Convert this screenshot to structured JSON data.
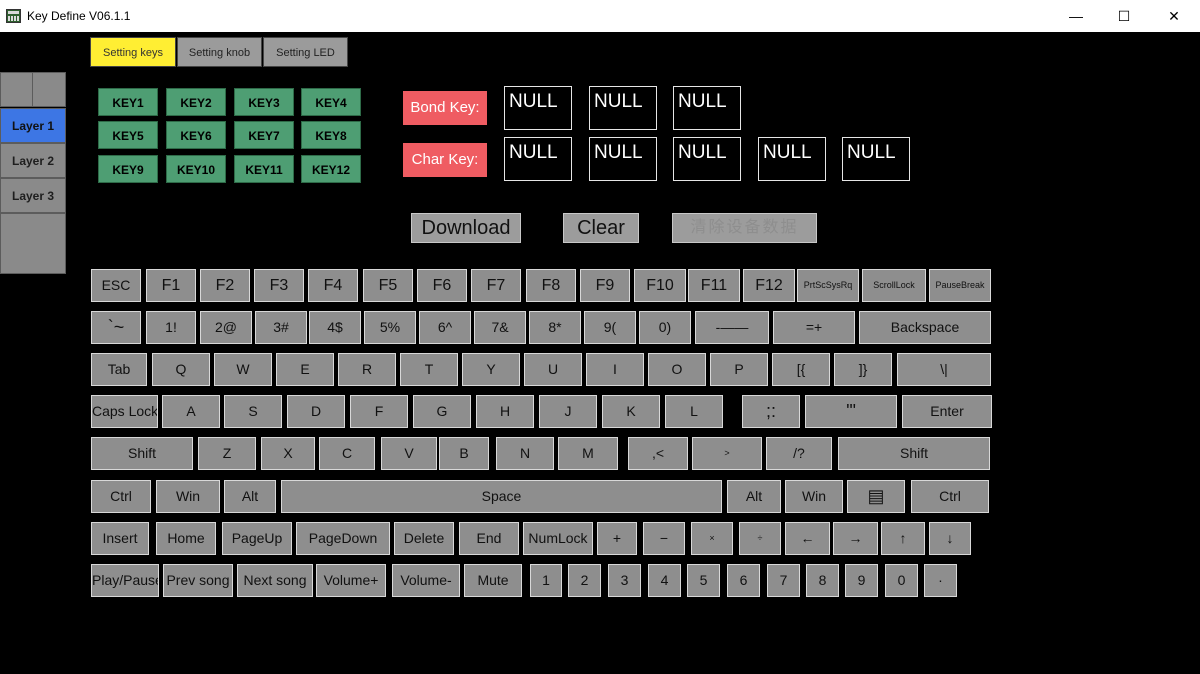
{
  "window": {
    "title": "Key Define V06.1.1",
    "minimize_icon": "—",
    "maximize_icon": "☐",
    "close_icon": "✕"
  },
  "tabs": [
    "Setting keys",
    "Setting knob",
    "Setting LED"
  ],
  "layers": [
    "Layer 1",
    "Layer 2",
    "Layer 3"
  ],
  "keys": [
    "KEY1",
    "KEY2",
    "KEY3",
    "KEY4",
    "KEY5",
    "KEY6",
    "KEY7",
    "KEY8",
    "KEY9",
    "KEY10",
    "KEY11",
    "KEY12"
  ],
  "bond": {
    "label": "Bond Key:",
    "values": [
      "NULL",
      "NULL",
      "NULL"
    ]
  },
  "char": {
    "label": "Char Key:",
    "values": [
      "NULL",
      "NULL",
      "NULL",
      "NULL",
      "NULL"
    ]
  },
  "actions": {
    "download": "Download",
    "clear": "Clear",
    "clear_device": "清除设备数据"
  },
  "keyboard": [
    [
      "ESC",
      "F1",
      "F2",
      "F3",
      "F4",
      "F5",
      "F6",
      "F7",
      "F8",
      "F9",
      "F10",
      "F11",
      "F12",
      "PrtScSysRq",
      "ScrollLock",
      "PauseBreak"
    ],
    [
      "`~",
      "1!",
      "2@",
      "3#",
      "4$",
      "5%",
      "6^",
      "7&",
      "8*",
      "9(",
      "0)",
      "-——",
      "=+",
      "Backspace"
    ],
    [
      "Tab",
      "Q",
      "W",
      "E",
      "R",
      "T",
      "Y",
      "U",
      "I",
      "O",
      "P",
      "[{",
      "]}",
      "\\|"
    ],
    [
      "Caps Lock",
      "A",
      "S",
      "D",
      "F",
      "G",
      "H",
      "J",
      "K",
      "L",
      ";:",
      "'\"",
      "Enter"
    ],
    [
      "Shift",
      "Z",
      "X",
      "C",
      "V",
      "B",
      "N",
      "M",
      ",<",
      ">",
      "/?",
      "Shift"
    ],
    [
      "Ctrl",
      "Win",
      "Alt",
      "Space",
      "Alt",
      "Win",
      "▤",
      "Ctrl"
    ],
    [
      "Insert",
      "Home",
      "PageUp",
      "PageDown",
      "Delete",
      "End",
      "NumLock",
      "+",
      "−",
      "×",
      "÷",
      "←",
      "→",
      "↑",
      "↓"
    ],
    [
      "Play/Pause",
      "Prev song",
      "Next song",
      "Volume+",
      "Volume-",
      "Mute",
      "1",
      "2",
      "3",
      "4",
      "5",
      "6",
      "7",
      "8",
      "9",
      "0",
      "·"
    ]
  ]
}
